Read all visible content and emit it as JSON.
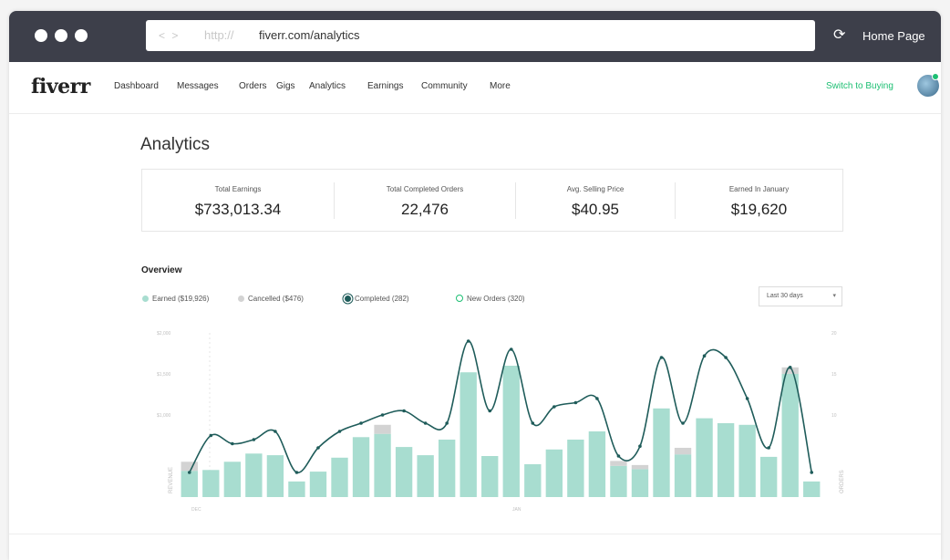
{
  "browser": {
    "nav_arrows": "< >",
    "protocol": "http://",
    "url": "fiverr.com/analytics",
    "reload_glyph": "⟳",
    "home_label": "Home Page"
  },
  "nav": {
    "logo": "fiverr",
    "items": [
      "Dashboard",
      "Messages",
      "Orders",
      "Gigs",
      "Analytics",
      "Earnings",
      "Community",
      "More"
    ],
    "switch_label": "Switch to Buying"
  },
  "page": {
    "title": "Analytics",
    "stats": [
      {
        "label": "Total Earnings",
        "value": "$733,013.34"
      },
      {
        "label": "Total Completed Orders",
        "value": "22,476"
      },
      {
        "label": "Avg. Selling Price",
        "value": "$40.95"
      },
      {
        "label": "Earned In January",
        "value": "$19,620"
      }
    ],
    "overview_title": "Overview",
    "legend": [
      {
        "label": "Earned ($19,926)",
        "color": "#a8ddd0",
        "style": "filled"
      },
      {
        "label": "Cancelled ($476)",
        "color": "#d3d3d3",
        "style": "filled"
      },
      {
        "label": "Completed (282)",
        "color": "#1f5c5a",
        "style": "ring"
      },
      {
        "label": "New Orders (320)",
        "color": "#1dbf73",
        "style": "outline"
      }
    ],
    "range_select": "Last 30 days",
    "caret_glyph": "▾"
  },
  "colors": {
    "titlebar": "#3d3f4a",
    "brand_green": "#1dbf73",
    "earned_bar": "#a8ddd0",
    "cancelled_bar": "#d3d3d3",
    "completed_line": "#1f5c5a"
  },
  "chart_data": {
    "type": "bar",
    "left_axis": {
      "label": "REVENUE",
      "ticks": [
        "$2,000",
        "$1,500",
        "$1,000"
      ],
      "tick_values": [
        2000,
        1500,
        1000
      ],
      "ylim": [
        0,
        2000
      ]
    },
    "right_axis": {
      "label": "ORDERS",
      "ticks": [
        "20",
        "15",
        "10"
      ],
      "tick_values": [
        20,
        15,
        10
      ],
      "ylim": [
        0,
        20
      ]
    },
    "x_ticks": [
      "DEC",
      "JAN"
    ],
    "grid": false,
    "series": [
      {
        "name": "Earned",
        "values": [
          320,
          330,
          430,
          530,
          510,
          190,
          310,
          480,
          730,
          770,
          610,
          510,
          700,
          1520,
          500,
          1600,
          400,
          580,
          700,
          800,
          380,
          340,
          1080,
          520,
          960,
          900,
          880,
          490,
          1500,
          190
        ]
      },
      {
        "name": "Cancelled",
        "values": [
          110,
          0,
          0,
          0,
          0,
          0,
          0,
          0,
          0,
          110,
          0,
          0,
          0,
          0,
          0,
          0,
          0,
          0,
          0,
          0,
          60,
          50,
          0,
          80,
          0,
          0,
          0,
          0,
          80,
          0
        ]
      },
      {
        "name": "Completed",
        "values": [
          3,
          7.5,
          6.5,
          7,
          8,
          3,
          6,
          8,
          9,
          10,
          10.5,
          9,
          9,
          19,
          10.5,
          18,
          9,
          11,
          11.5,
          12,
          5,
          6.2,
          17,
          9,
          17.2,
          17,
          12,
          6,
          15.8,
          3
        ]
      }
    ]
  }
}
